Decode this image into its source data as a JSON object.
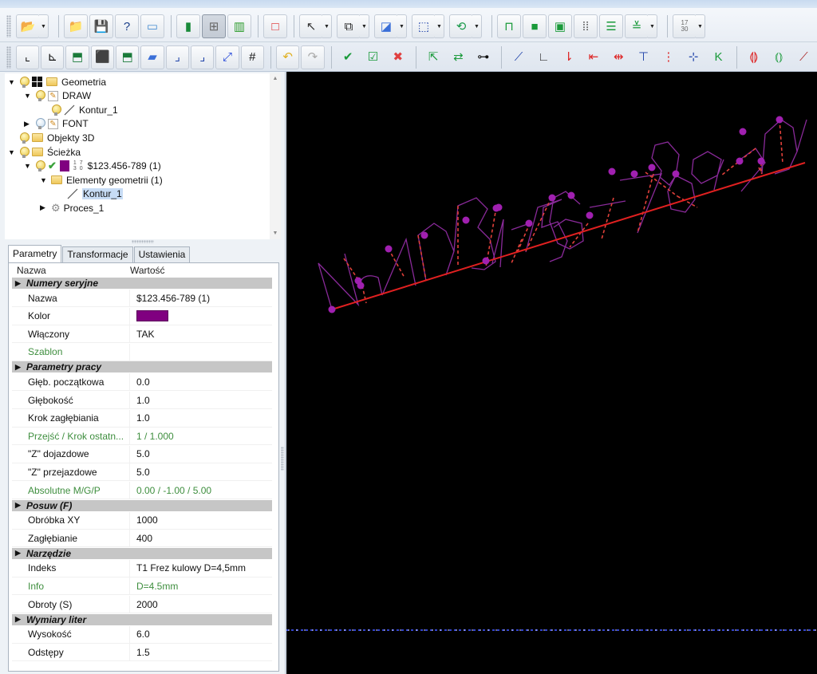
{
  "toolbar": {
    "row1": [
      {
        "name": "open-button",
        "icon": "📂",
        "dropdown": true
      },
      {
        "name": "new-project-button",
        "icon": "📁"
      },
      {
        "name": "save-button",
        "icon": "💾"
      },
      {
        "name": "help-button",
        "icon": "?"
      },
      {
        "name": "document-button",
        "icon": "▭"
      },
      {
        "name": "layers-color-button",
        "icon": "▮"
      },
      {
        "name": "grid-view-button",
        "icon": "⊞",
        "active": true
      },
      {
        "name": "chart-button",
        "icon": "▥"
      },
      {
        "name": "rectangle-select-button",
        "icon": "□"
      },
      {
        "name": "pointer-button",
        "icon": "↖",
        "dropdown": true
      },
      {
        "name": "layout-button",
        "icon": "⧉",
        "dropdown": true
      },
      {
        "name": "shapes-button",
        "icon": "◪",
        "dropdown": true
      },
      {
        "name": "nodes-button",
        "icon": "⬚",
        "dropdown": true
      },
      {
        "name": "cycle-button",
        "icon": "⟲",
        "dropdown": true
      },
      {
        "name": "zigzag-path-button",
        "icon": "⊓"
      },
      {
        "name": "pocket-button",
        "icon": "■"
      },
      {
        "name": "contour-offset-button",
        "icon": "▣"
      },
      {
        "name": "dots-grid-button",
        "icon": "⁞⁞"
      },
      {
        "name": "parallel-lines-button",
        "icon": "☰"
      },
      {
        "name": "hatch-button",
        "icon": "≚",
        "dropdown": true
      },
      {
        "name": "serial-number-button",
        "icon": "17\n30",
        "dropdown": true
      }
    ],
    "row2": [
      {
        "name": "axis-2d-button",
        "icon": "⌞"
      },
      {
        "name": "axis-3d-button",
        "icon": "⊾"
      },
      {
        "name": "wireframe-view-button",
        "icon": "⬒"
      },
      {
        "name": "solid-green-view-button",
        "icon": "⬛"
      },
      {
        "name": "transparent-view-button",
        "icon": "⬒"
      },
      {
        "name": "blue-solid-view-button",
        "icon": "▰"
      },
      {
        "name": "small-step-button",
        "icon": "⌟"
      },
      {
        "name": "step-button",
        "icon": "⌟"
      },
      {
        "name": "zoom-fit-button",
        "icon": "⤢"
      },
      {
        "name": "grid-toggle-button",
        "icon": "#"
      },
      {
        "name": "undo-button",
        "icon": "↶"
      },
      {
        "name": "redo-button",
        "icon": "↷"
      },
      {
        "name": "accept-button",
        "icon": "✔"
      },
      {
        "name": "accept-selected-button",
        "icon": "☑"
      },
      {
        "name": "cancel-button",
        "icon": "✖"
      },
      {
        "name": "select-start-button",
        "icon": "⇱"
      },
      {
        "name": "select-direction-button",
        "icon": "⇄",
        "active": true
      },
      {
        "name": "bridge-button",
        "icon": "⊶"
      },
      {
        "name": "split-button",
        "icon": "⟋"
      },
      {
        "name": "angle-button",
        "icon": "∟"
      },
      {
        "name": "vertical-lead-button",
        "icon": "⇂"
      },
      {
        "name": "horizontal-lead-button",
        "icon": "⇤"
      },
      {
        "name": "center-lead-button",
        "icon": "⇹"
      },
      {
        "name": "corner-lead-button",
        "icon": "⊤"
      },
      {
        "name": "dashed-lead-button",
        "icon": "⋮"
      },
      {
        "name": "point-lead-button",
        "icon": "⊹"
      },
      {
        "name": "k-lead-button",
        "icon": "K"
      },
      {
        "name": "measure-red-button",
        "icon": "⟬⟭"
      },
      {
        "name": "measure-green-button",
        "icon": "⦅⦆"
      },
      {
        "name": "measure-box-button",
        "icon": "⟋"
      }
    ]
  },
  "tree": {
    "items": [
      {
        "label": "Geometria",
        "level": 0,
        "expanded": true,
        "icons": [
          "bulb",
          "grid",
          "folder"
        ]
      },
      {
        "label": "DRAW",
        "level": 1,
        "expanded": true,
        "icons": [
          "bulb",
          "pencil"
        ]
      },
      {
        "label": "Kontur_1",
        "level": 2,
        "icons": [
          "bulb",
          "line"
        ]
      },
      {
        "label": "FONT",
        "level": 1,
        "expanded": false,
        "icons": [
          "bulb-off",
          "pencil"
        ]
      },
      {
        "label": "Objekty 3D",
        "level": 0,
        "icons": [
          "bulb",
          "folder"
        ]
      },
      {
        "label": "Ścieżka",
        "level": 0,
        "expanded": true,
        "icons": [
          "bulb",
          "folder"
        ]
      },
      {
        "label": "$123.456-789 (1)",
        "level": 1,
        "expanded": true,
        "icons": [
          "bulb",
          "check",
          "color",
          "serial"
        ]
      },
      {
        "label": "Elementy geometrii (1)",
        "level": 2,
        "expanded": true,
        "icons": [
          "folder"
        ]
      },
      {
        "label": "Kontur_1",
        "level": 3,
        "icons": [
          "line"
        ],
        "selected": true
      },
      {
        "label": "Proces_1",
        "level": 2,
        "expanded": false,
        "icons": [
          "gear"
        ]
      }
    ],
    "serial_icon_text": "1 7\n3 0"
  },
  "tabs": [
    {
      "label": "Parametry",
      "active": true
    },
    {
      "label": "Transformacje"
    },
    {
      "label": "Ustawienia"
    }
  ],
  "props": {
    "headers": {
      "name": "Nazwa",
      "value": "Wartość"
    },
    "rows": [
      {
        "type": "cat",
        "label": "Numery seryjne"
      },
      {
        "type": "item",
        "label": "Nazwa",
        "value": "$123.456-789 (1)"
      },
      {
        "type": "item",
        "label": "Kolor",
        "value": "",
        "swatch": "#800080"
      },
      {
        "type": "item",
        "label": "Włączony",
        "value": "TAK"
      },
      {
        "type": "item",
        "label": "Szablon",
        "value": "",
        "green": true
      },
      {
        "type": "cat",
        "label": "Parametry pracy"
      },
      {
        "type": "item",
        "label": "Głęb. początkowa",
        "value": "0.0"
      },
      {
        "type": "item",
        "label": "Głębokość",
        "value": "1.0"
      },
      {
        "type": "item",
        "label": "Krok zagłębiania",
        "value": "1.0"
      },
      {
        "type": "item",
        "label": "Przejść / Krok ostatn...",
        "value": "1 / 1.000",
        "green": true
      },
      {
        "type": "item",
        "label": "\"Z\" dojazdowe",
        "value": "5.0"
      },
      {
        "type": "item",
        "label": "\"Z\" przejazdowe",
        "value": "5.0"
      },
      {
        "type": "item",
        "label": "Absolutne M/G/P",
        "value": "0.00 / -1.00 / 5.00",
        "green": true
      },
      {
        "type": "cat",
        "label": "Posuw (F)"
      },
      {
        "type": "item",
        "label": "Obróbka XY",
        "value": "1000"
      },
      {
        "type": "item",
        "label": "Zagłębianie",
        "value": "400"
      },
      {
        "type": "cat",
        "label": "Narzędzie"
      },
      {
        "type": "item",
        "label": "Indeks",
        "value": "T1 Frez kulowy D=4,5mm"
      },
      {
        "type": "item",
        "label": "Info",
        "value": "D=4.5mm",
        "green": true
      },
      {
        "type": "item",
        "label": "Obroty (S)",
        "value": "2000"
      },
      {
        "type": "cat",
        "label": "Wymiary liter"
      },
      {
        "type": "item",
        "label": "Wysokość",
        "value": "6.0"
      },
      {
        "type": "item",
        "label": "Odstępy",
        "value": "1.5"
      }
    ]
  },
  "canvas": {
    "engraved_text": "Nº123.456-789 (1)",
    "colors": {
      "background": "#000000",
      "glyph_outline": "#8a2a9a",
      "baseline": "#e02020",
      "lead_in": "#e0403a",
      "markers": "#a020b0",
      "ground_line": "#3344cc"
    }
  }
}
